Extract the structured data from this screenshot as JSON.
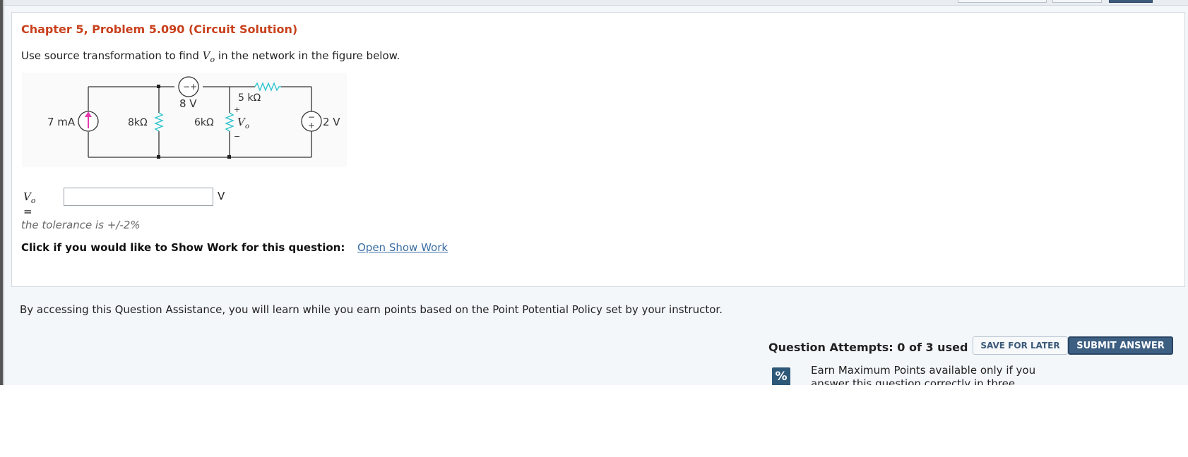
{
  "problem": {
    "title": "Chapter 5, Problem 5.090 (Circuit Solution)",
    "prompt_before": "Use source transformation to find ",
    "prompt_var": "V",
    "prompt_sub": "o",
    "prompt_after": " in the network in the figure below."
  },
  "circuit": {
    "current_source": "7 mA",
    "r1": "8kΩ",
    "voltage_source_top": "8 V",
    "r2": "6kΩ",
    "r3": "5 kΩ",
    "vo_plus": "+",
    "vo_label": "V",
    "vo_sub": "o",
    "vo_minus": "−",
    "voltage_source_right": "2 V"
  },
  "answer": {
    "label_var": "V",
    "label_sub": "o",
    "label_eq": "=",
    "value": "",
    "unit": "V"
  },
  "tolerance_text": "the tolerance is +/-2%",
  "show_work": {
    "prompt": "Click if you would like to Show Work for this question:",
    "link": "Open Show Work"
  },
  "assistance_text": "By accessing this Question Assistance, you will learn while you earn points based on the Point Potential Policy set by your instructor.",
  "attempts_text": "Question Attempts: 0 of 3 used",
  "buttons": {
    "save": "SAVE FOR LATER",
    "submit": "SUBMIT ANSWER"
  },
  "earn_icon": "percent-icon",
  "earn_icon_glyph": "%",
  "earn_text": "Earn Maximum Points available only if you answer this question correctly in three"
}
